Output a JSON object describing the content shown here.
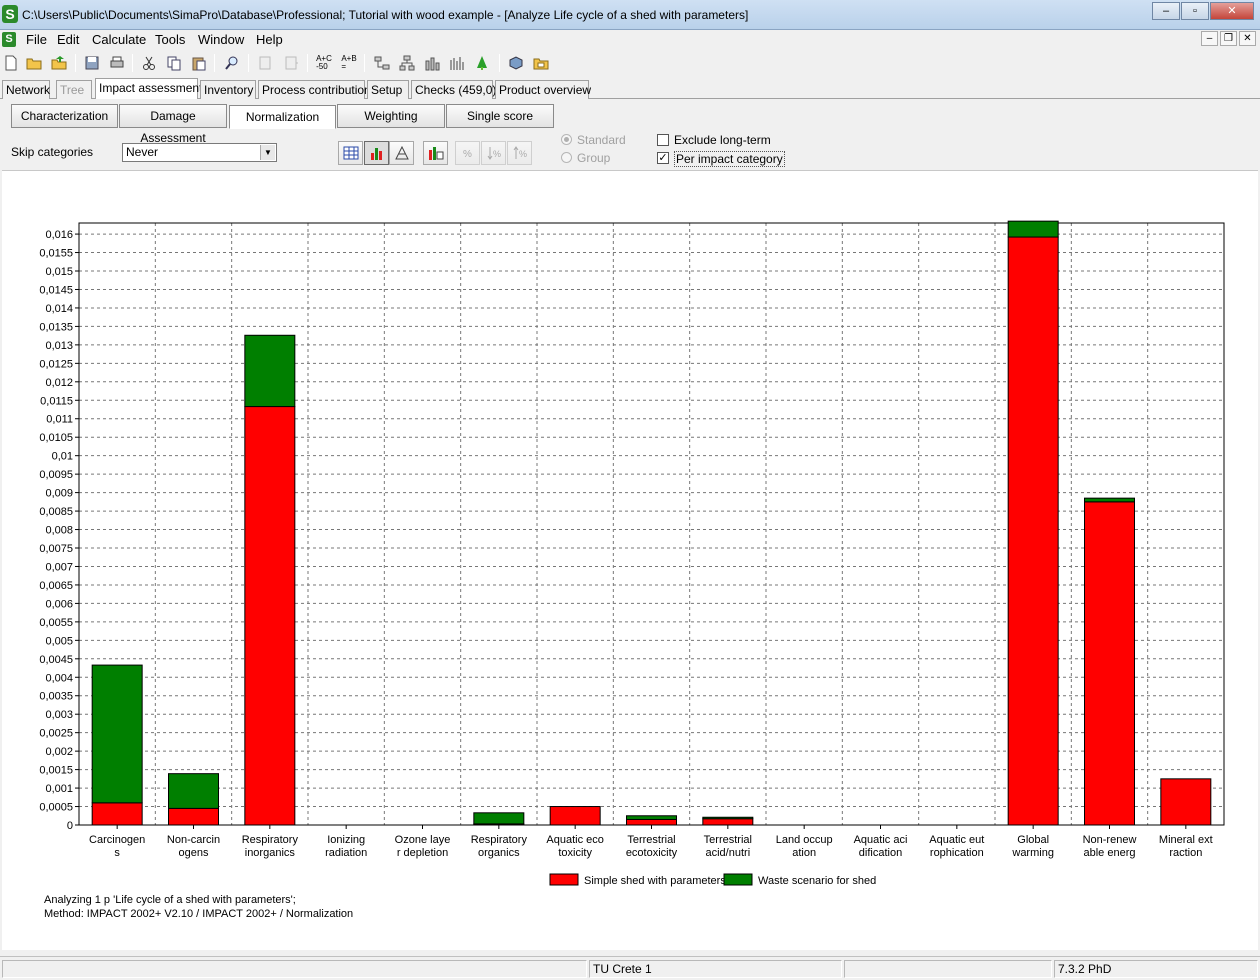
{
  "window": {
    "title": "C:\\Users\\Public\\Documents\\SimaPro\\Database\\Professional; Tutorial with wood example - [Analyze Life cycle of a shed with parameters]",
    "minimize": "–",
    "maximize": "▫",
    "close": "✕"
  },
  "menu": [
    "File",
    "Edit",
    "Calculate",
    "Tools",
    "Window",
    "Help"
  ],
  "tabs": [
    "Network",
    "Tree",
    "Impact assessment",
    "Inventory",
    "Process contribution",
    "Setup",
    "Checks (459,0)",
    "Product overview"
  ],
  "subtabs": [
    "Characterization",
    "Damage Assessment",
    "Normalization",
    "Weighting",
    "Single score"
  ],
  "controls": {
    "skip_label": "Skip categories",
    "skip_value": "Never",
    "radio_standard": "Standard",
    "radio_group": "Group",
    "exclude_label": "Exclude long-term",
    "per_impact_label": "Per impact category",
    "per_impact_checked": "✓"
  },
  "chart_data": {
    "type": "bar",
    "stacked": true,
    "ylim": [
      0,
      0.0163
    ],
    "y_ticks": [
      "0",
      "0,0005",
      "0,001",
      "0,0015",
      "0,002",
      "0,0025",
      "0,003",
      "0,0035",
      "0,004",
      "0,0045",
      "0,005",
      "0,0055",
      "0,006",
      "0,0065",
      "0,007",
      "0,0075",
      "0,008",
      "0,0085",
      "0,009",
      "0,0095",
      "0,01",
      "0,0105",
      "0,011",
      "0,0115",
      "0,012",
      "0,0125",
      "0,013",
      "0,0135",
      "0,014",
      "0,0145",
      "0,015",
      "0,0155",
      "0,016"
    ],
    "categories": [
      [
        "Carcinogen",
        "s"
      ],
      [
        "Non-carcin",
        "ogens"
      ],
      [
        "Respiratory",
        "inorganics"
      ],
      [
        "Ionizing",
        "radiation"
      ],
      [
        "Ozone laye",
        "r depletion"
      ],
      [
        "Respiratory",
        "organics"
      ],
      [
        "Aquatic eco",
        "toxicity"
      ],
      [
        "Terrestrial",
        "ecotoxicity"
      ],
      [
        "Terrestrial",
        "acid/nutri"
      ],
      [
        "Land occup",
        "ation"
      ],
      [
        "Aquatic aci",
        "dification"
      ],
      [
        "Aquatic eut",
        "rophication"
      ],
      [
        "Global",
        "warming"
      ],
      [
        "Non-renew",
        "able energ"
      ],
      [
        "Mineral ext",
        "raction"
      ]
    ],
    "series": [
      {
        "name": "Simple shed with parameters",
        "color": "#ff0000",
        "values": [
          0.0006,
          0.00045,
          0.01133,
          0.0,
          0.0,
          3e-05,
          0.0005,
          0.00015,
          0.00017,
          0.0,
          0.0,
          0.0,
          0.01592,
          0.00875,
          0.00125
        ]
      },
      {
        "name": "Waste scenario for shed",
        "color": "#007f00",
        "values": [
          0.00373,
          0.00094,
          0.00193,
          0.0,
          0.0,
          0.0003,
          0.0,
          0.0001,
          4e-05,
          0.0,
          0.0,
          0.0,
          0.00043,
          0.0001,
          0.0
        ]
      }
    ],
    "grid": true,
    "legend": "bottom-center"
  },
  "footnote": {
    "line1": "Analyzing 1 p 'Life cycle of a shed with parameters';",
    "line2": "Method: IMPACT 2002+ V2.10 / IMPACT 2002+ / Normalization"
  },
  "status": {
    "center": "TU Crete 1",
    "version": "7.3.2 PhD"
  }
}
